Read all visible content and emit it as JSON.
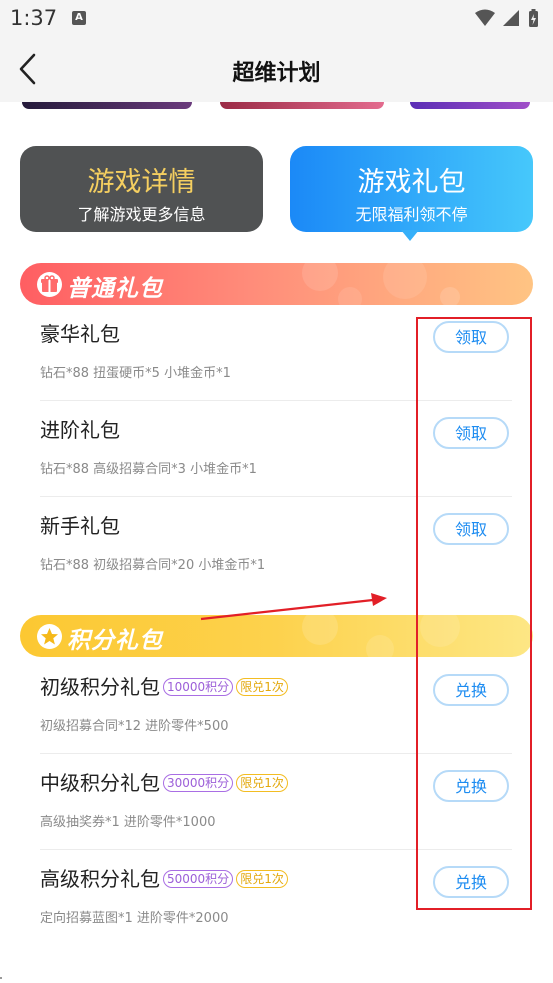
{
  "status_bar": {
    "time": "1:37",
    "notif_letter": "A"
  },
  "header": {
    "title": "超维计划"
  },
  "tabs": [
    {
      "title": "游戏详情",
      "subtitle": "了解游戏更多信息"
    },
    {
      "title": "游戏礼包",
      "subtitle": "无限福利领不停"
    }
  ],
  "sections": {
    "normal": {
      "title": "普通礼包"
    },
    "points": {
      "title": "积分礼包"
    }
  },
  "normal_items": [
    {
      "name": "豪华礼包",
      "desc": "钻石*88 扭蛋硬币*5 小堆金币*1",
      "button": "领取"
    },
    {
      "name": "进阶礼包",
      "desc": "钻石*88 高级招募合同*3 小堆金币*1",
      "button": "领取"
    },
    {
      "name": "新手礼包",
      "desc": "钻石*88 初级招募合同*20 小堆金币*1",
      "button": "领取"
    }
  ],
  "points_items": [
    {
      "name": "初级积分礼包",
      "points": "10000积分",
      "limit": "限兑1次",
      "desc": "初级招募合同*12 进阶零件*500",
      "button": "兑换"
    },
    {
      "name": "中级积分礼包",
      "points": "30000积分",
      "limit": "限兑1次",
      "desc": "高级抽奖券*1 进阶零件*1000",
      "button": "兑换"
    },
    {
      "name": "高级积分礼包",
      "points": "50000积分",
      "limit": "限兑1次",
      "desc": "定向招募蓝图*1 进阶零件*2000",
      "button": "兑换"
    }
  ],
  "colors": {
    "accent_blue": "#1d8cf1",
    "annotation_red": "#e21f27",
    "normal_gradient_start": "#ff5e62",
    "points_gradient_start": "#fcc832"
  }
}
